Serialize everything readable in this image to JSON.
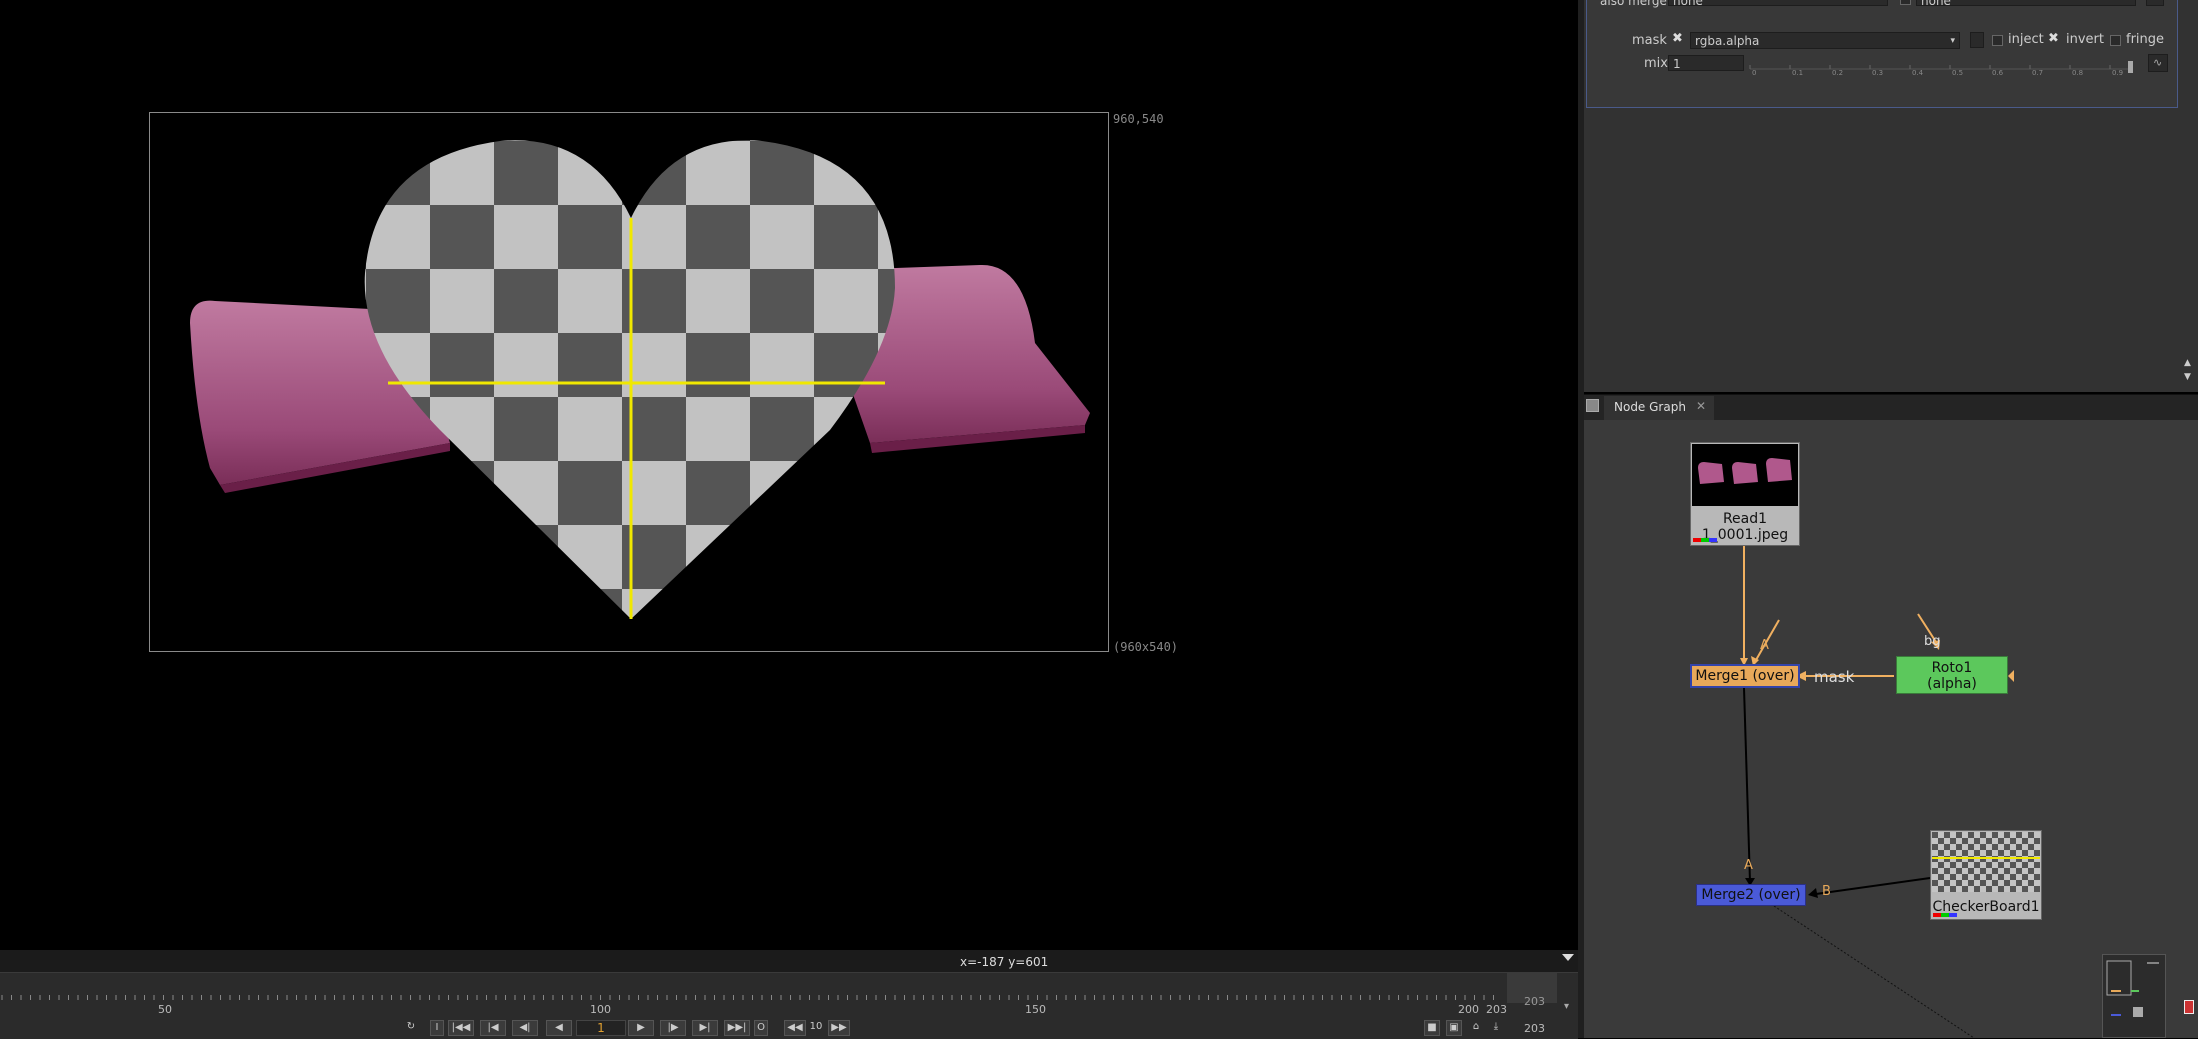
{
  "viewer": {
    "format_top": "960,540",
    "format_bottom": "(960x540)",
    "coords": "x=-187 y=601"
  },
  "timeline": {
    "tick_labels": [
      "50",
      "100",
      "150",
      "200",
      "203"
    ],
    "end_frame": "203",
    "end_frame_bottom": "203",
    "current_frame": "1",
    "step": "10"
  },
  "properties": {
    "also_merge_label": "also merge",
    "also_merge_value": "none",
    "also_merge_value2": "none",
    "mask_label": "mask",
    "mask_value": "rgba.alpha",
    "inject_label": "inject",
    "invert_label": "invert",
    "fringe_label": "fringe",
    "mix_label": "mix",
    "mix_value": "1",
    "slider_ticks": [
      "0",
      "0.1",
      "0.2",
      "0.3",
      "0.4",
      "0.5",
      "0.6",
      "0.7",
      "0.8",
      "0.9"
    ]
  },
  "node_graph": {
    "tab_label": "Node Graph",
    "nodes": {
      "read1": {
        "name": "Read1",
        "file": "1_0001.jpeg"
      },
      "merge1": {
        "name": "Merge1 (over)"
      },
      "roto1": {
        "name": "Roto1",
        "sub": "(alpha)"
      },
      "merge2": {
        "name": "Merge2 (over)"
      },
      "checker": {
        "name": "CheckerBoard1"
      }
    },
    "inputs": {
      "a": "A",
      "b": "B",
      "mask": "mask",
      "bg": "bg"
    }
  },
  "colors": {
    "merge1": "#e8a95a",
    "merge2": "#4a5ad8",
    "roto": "#5cc85c",
    "pipe": "#f0b060",
    "heart_line": "#f0e800",
    "couch": "#b0588c"
  }
}
